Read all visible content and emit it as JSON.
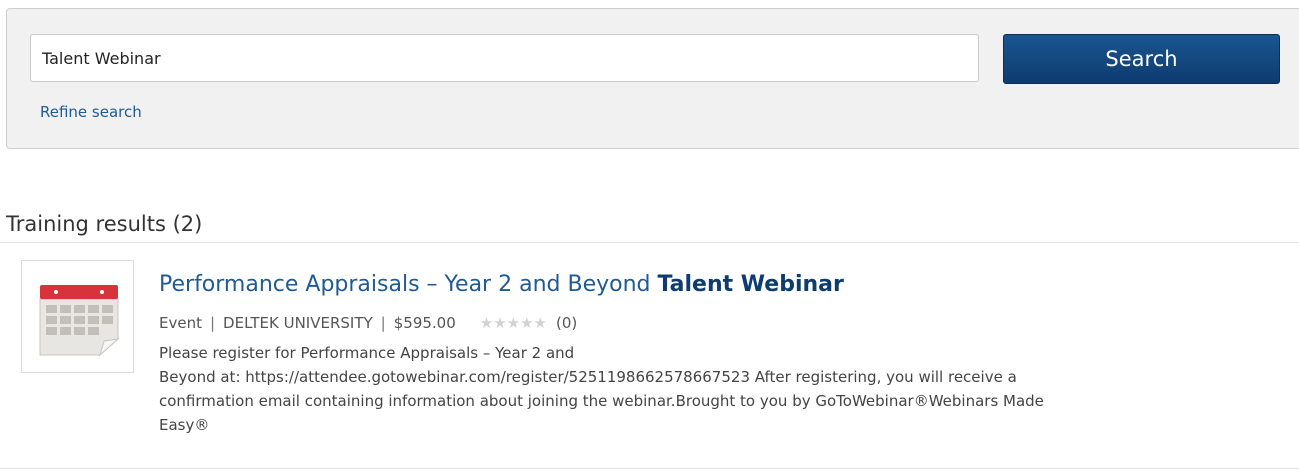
{
  "search": {
    "value": "Talent Webinar",
    "button_label": "Search",
    "refine_label": "Refine search"
  },
  "results": {
    "heading": "Training results (2)",
    "items": [
      {
        "icon": "calendar-icon",
        "title_main": "Performance Appraisals – Year 2 and Beyond ",
        "title_highlight": "Talent Webinar",
        "type": "Event",
        "provider": "DELTEK UNIVERSITY",
        "price": "$595.00",
        "rating_stars": "★★★★★",
        "rating_value": 0,
        "rating_count": "(0)",
        "description_lines": [
          "Please register for Performance Appraisals – Year 2 and",
          "Beyond at: https://attendee.gotowebinar.com/register/5251198662578667523 After registering, you will receive a",
          "confirmation email containing information about joining the webinar.Brought to you by GoToWebinar®Webinars Made",
          "Easy®"
        ]
      }
    ]
  },
  "colors": {
    "accent": "#0d3c6f",
    "link": "#1f5a96",
    "calendar_red": "#d8323a"
  }
}
